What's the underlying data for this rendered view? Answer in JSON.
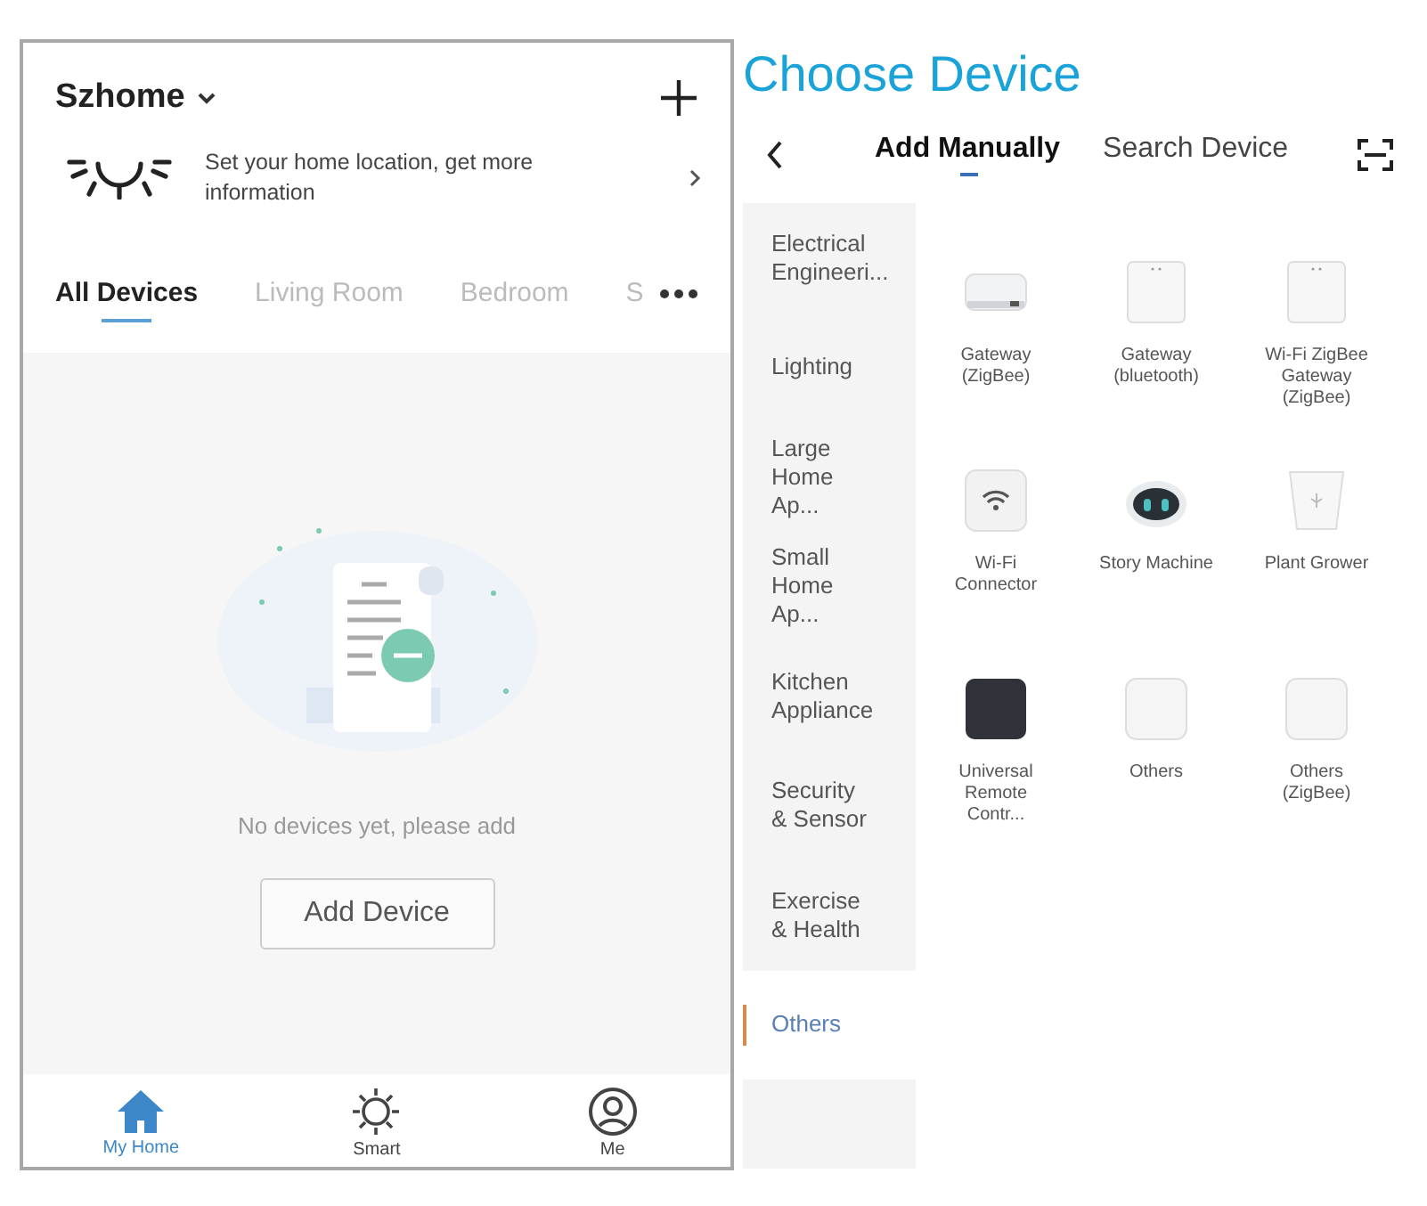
{
  "home": {
    "name": "Szhome",
    "location_prompt": "Set your home location, get more information",
    "room_tabs": [
      {
        "label": "All Devices",
        "selected": true
      },
      {
        "label": "Living Room",
        "selected": false
      },
      {
        "label": "Bedroom",
        "selected": false
      },
      {
        "label": "S",
        "selected": false
      }
    ],
    "empty_message": "No devices yet, please add",
    "add_button": "Add Device",
    "bottom_nav": [
      {
        "label": "My Home",
        "kind": "home",
        "selected": true
      },
      {
        "label": "Smart",
        "kind": "smart",
        "selected": false
      },
      {
        "label": "Me",
        "kind": "me",
        "selected": false
      }
    ]
  },
  "choose_device": {
    "title": "Choose Device",
    "tabs": [
      {
        "label": "Add Manually",
        "selected": true
      },
      {
        "label": "Search Device",
        "selected": false
      }
    ],
    "categories": [
      {
        "label": "Electrical Engineeri...",
        "selected": false
      },
      {
        "label": "Lighting",
        "selected": false
      },
      {
        "label": "Large Home Ap...",
        "selected": false
      },
      {
        "label": "Small Home Ap...",
        "selected": false
      },
      {
        "label": "Kitchen Appliance",
        "selected": false
      },
      {
        "label": "Security & Sensor",
        "selected": false
      },
      {
        "label": "Exercise & Health",
        "selected": false
      },
      {
        "label": "Others",
        "selected": true
      }
    ],
    "devices": [
      {
        "label": "Gateway (ZigBee)",
        "kind": "hub"
      },
      {
        "label": "Gateway (bluetooth)",
        "kind": "box"
      },
      {
        "label": "Wi-Fi ZigBee Gateway (ZigBee)",
        "kind": "box"
      },
      {
        "label": "Wi-Fi Connector",
        "kind": "wifi"
      },
      {
        "label": "Story Machine",
        "kind": "robot"
      },
      {
        "label": "Plant Grower",
        "kind": "pot"
      },
      {
        "label": "Universal Remote Contr...",
        "kind": "dark"
      },
      {
        "label": "Others",
        "kind": "square"
      },
      {
        "label": "Others (ZigBee)",
        "kind": "square"
      }
    ]
  }
}
